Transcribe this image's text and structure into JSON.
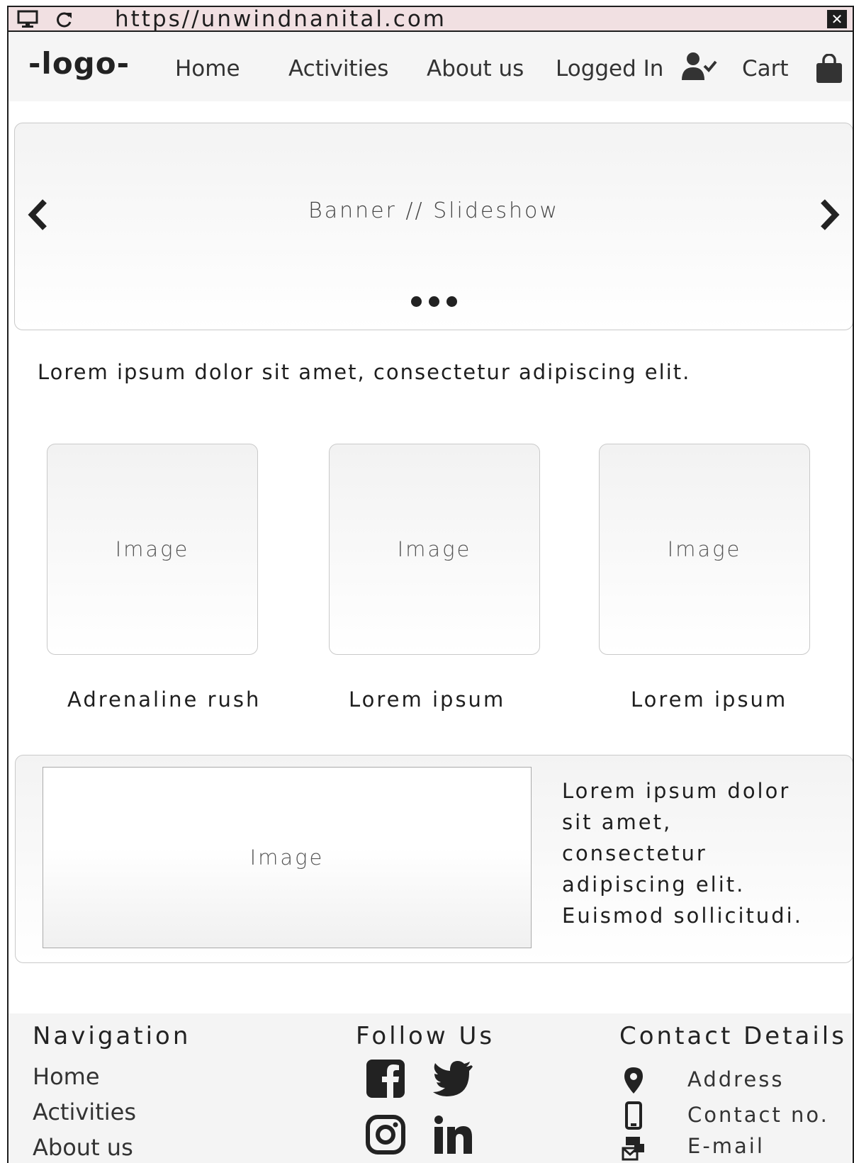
{
  "browser": {
    "url": "https//unwindnanital.com",
    "close_label": "✕",
    "icons": [
      "monitor-icon",
      "reload-icon",
      "close-icon"
    ]
  },
  "nav": {
    "logo": "-logo-",
    "home": "Home",
    "activities": "Activities",
    "about": "About us",
    "logged_in": "Logged In",
    "cart": "Cart",
    "icons": [
      "user-check-icon",
      "shopping-bag-icon"
    ]
  },
  "banner": {
    "label": "Banner // Slideshow",
    "icons": [
      "chevron-left-icon",
      "chevron-right-icon"
    ],
    "dots": 3
  },
  "intro_text": "Lorem ipsum dolor sit amet, consectetur adipiscing elit.",
  "cards": [
    {
      "image_label": "Image",
      "caption": "Adrenaline rush"
    },
    {
      "image_label": "Image",
      "caption": "Lorem ipsum"
    },
    {
      "image_label": "Image",
      "caption": "Lorem ipsum"
    }
  ],
  "feature": {
    "image_label": "Image",
    "lines": [
      "Lorem ipsum dolor",
      "sit amet,",
      "consectetur",
      "adipiscing elit.",
      "Euismod sollicitudi."
    ]
  },
  "footer": {
    "navigation_heading": "Navigation",
    "nav_links": [
      "Home",
      "Activities",
      "About us"
    ],
    "follow_heading": "Follow Us",
    "social_icons": [
      "facebook-icon",
      "twitter-icon",
      "instagram-icon",
      "linkedin-icon"
    ],
    "contact_heading": "Contact Details",
    "contacts": [
      {
        "icon": "map-pin-icon",
        "label": "Address"
      },
      {
        "icon": "phone-icon",
        "label": "Contact no."
      },
      {
        "icon": "email-icon",
        "label": "E-mail"
      }
    ]
  },
  "colors": {
    "browser_bar": "#f1e0e2",
    "nav_bg": "#f5f5f5",
    "footer_bg": "#f4f4f4",
    "ink": "#1e1e1e"
  }
}
